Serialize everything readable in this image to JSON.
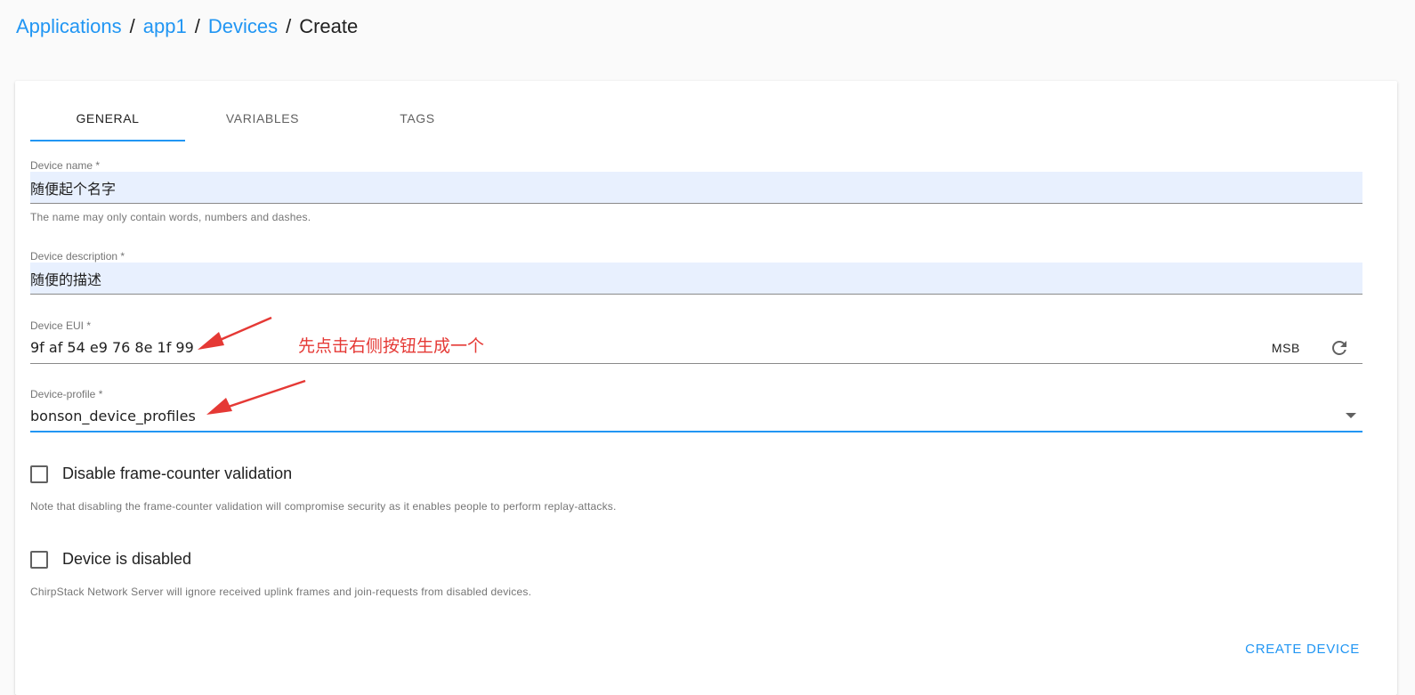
{
  "breadcrumb": {
    "items": [
      "Applications",
      "app1",
      "Devices"
    ],
    "separator": "/",
    "current": "Create"
  },
  "tabs": [
    {
      "label": "General",
      "active": true
    },
    {
      "label": "Variables",
      "active": false
    },
    {
      "label": "Tags",
      "active": false
    }
  ],
  "form": {
    "device_name": {
      "label": "Device name *",
      "value": "随便起个名字",
      "helper": "The name may only contain words, numbers and dashes."
    },
    "device_description": {
      "label": "Device description *",
      "value": "随便的描述"
    },
    "device_eui": {
      "label": "Device EUI *",
      "value": "9f af 54 e9 76 8e 1f 99",
      "byte_order_label": "MSB",
      "refresh_icon": "refresh-icon"
    },
    "device_profile": {
      "label": "Device-profile *",
      "value": "bonson_device_profiles",
      "dropdown_icon": "arrow-drop-down-icon"
    },
    "disable_frame_counter": {
      "label": "Disable frame-counter validation",
      "checked": false,
      "note": "Note that disabling the frame-counter validation will compromise security as it enables people to perform replay-attacks."
    },
    "device_disabled": {
      "label": "Device is disabled",
      "checked": false,
      "note": "ChirpStack Network Server will ignore received uplink frames and join-requests from disabled devices."
    }
  },
  "actions": {
    "create_label": "CREATE DEVICE"
  },
  "annotation": {
    "text": "先点击右侧按钮生成一个",
    "color": "#e53935"
  },
  "colors": {
    "accent": "#2196f3",
    "autofill_background": "#e8f0fe",
    "page_background": "#fafafa"
  }
}
